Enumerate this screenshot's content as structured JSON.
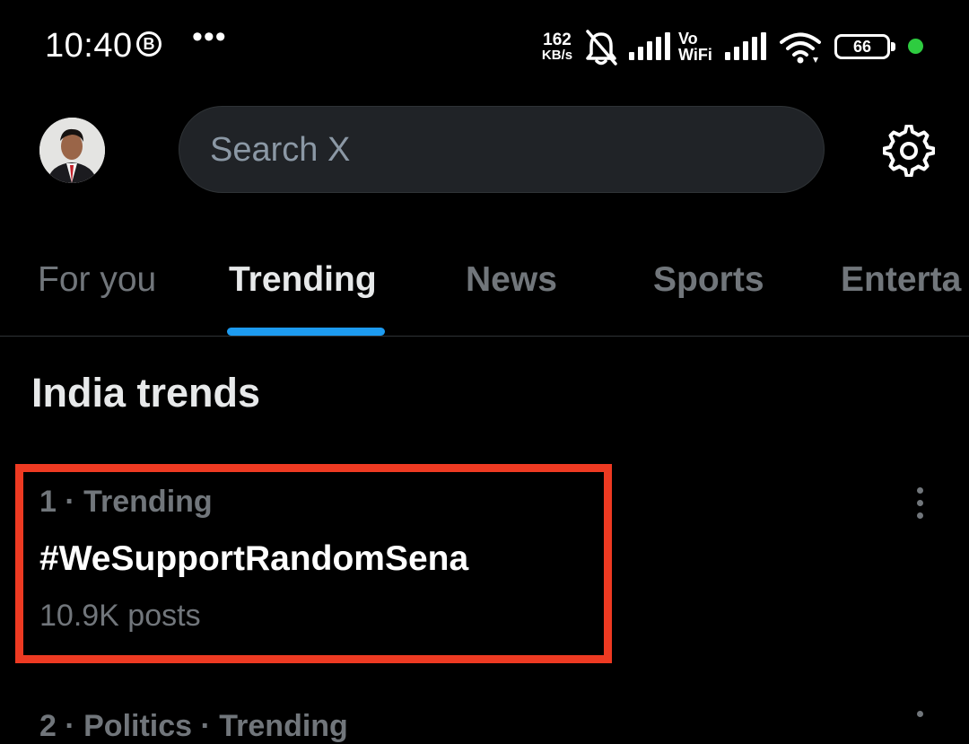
{
  "status_bar": {
    "time": "10:40",
    "badge_letter": "B",
    "more": "•••",
    "speed_value": "162",
    "speed_unit": "KB/s",
    "vo": "Vo",
    "wifi": "WiFi",
    "battery": "66",
    "icons": [
      "b-badge-icon",
      "bell-muted-icon",
      "signal-bars-icon",
      "wifi-icon",
      "battery-icon",
      "green-dot-icon"
    ]
  },
  "header": {
    "search_placeholder": "Search X",
    "icons": [
      "avatar",
      "gear-icon"
    ]
  },
  "tabs": [
    {
      "label": "For you"
    },
    {
      "label": "Trending"
    },
    {
      "label": "News"
    },
    {
      "label": "Sports"
    },
    {
      "label": "Enterta"
    }
  ],
  "section": {
    "title": "India trends"
  },
  "trends": [
    {
      "meta": "1 · Trending",
      "name": "#WeSupportRandomSena",
      "count": "10.9K posts"
    },
    {
      "meta": "2 · Politics · Trending"
    }
  ],
  "colors": {
    "background": "#000000",
    "accent": "#1d9bf0",
    "highlight": "#ee3a22",
    "muted_text": "#71767b",
    "search_fill": "#202327"
  }
}
